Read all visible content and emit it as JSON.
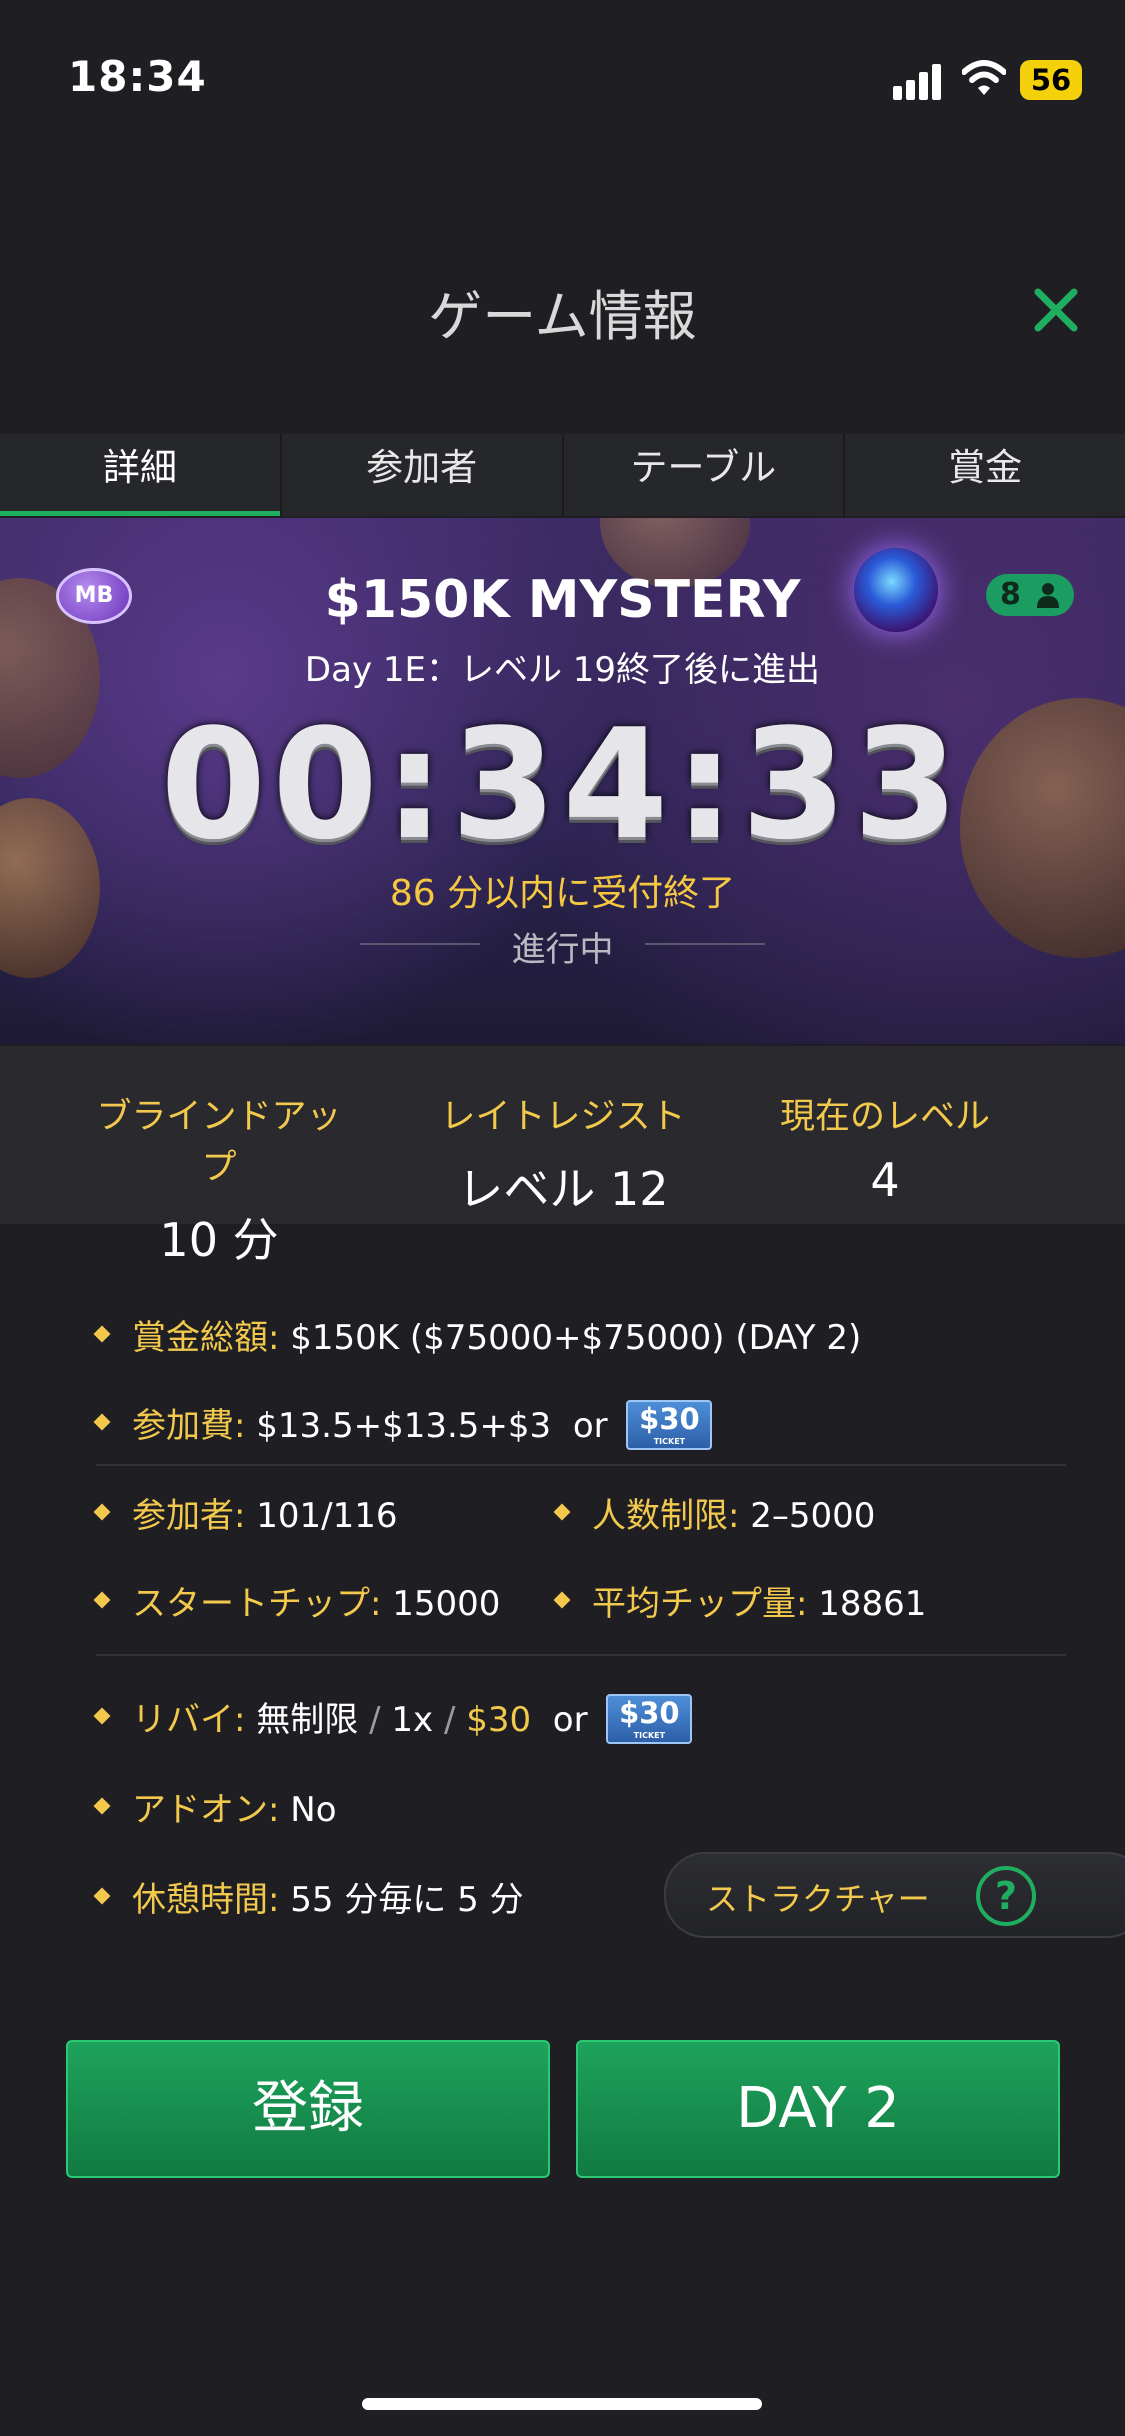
{
  "status_bar": {
    "time": "18:34",
    "battery": "56"
  },
  "header": {
    "title": "ゲーム情報"
  },
  "tabs": [
    {
      "label": "詳細",
      "active": true
    },
    {
      "label": "参加者",
      "active": false
    },
    {
      "label": "テーブル",
      "active": false
    },
    {
      "label": "賞金",
      "active": false
    }
  ],
  "banner": {
    "badge": "MB",
    "title": "$150K MYSTERY",
    "players": "8",
    "subtitle": "Day 1E：レベル 19終了後に進出",
    "countdown": "00:34:33",
    "registration_close": "86 分以内に受付終了",
    "status": "進行中"
  },
  "stats": {
    "blind_up": {
      "label": "ブラインドアップ",
      "value": "10 分"
    },
    "late_reg": {
      "label": "レイトレジスト",
      "value": "レベル 12"
    },
    "current_level": {
      "label": "現在のレベル",
      "value": "4"
    }
  },
  "info": {
    "prize_pool": {
      "key": "賞金総額:",
      "value": "$150K ($75000+$75000) (DAY 2)"
    },
    "buyin": {
      "key": "参加費:",
      "value": "$13.5+$13.5+$3",
      "or": "or",
      "ticket": "$30",
      "ticket_sub": "TICKET"
    },
    "entrants": {
      "key": "参加者:",
      "value": "101/116"
    },
    "player_limit": {
      "key": "人数制限:",
      "value": "2–5000"
    },
    "starting_chips": {
      "key": "スタートチップ:",
      "value": "15000"
    },
    "avg_chips": {
      "key": "平均チップ量:",
      "value": "18861"
    },
    "rebuy": {
      "key": "リバイ:",
      "value_a": "無制限",
      "slash": "/",
      "value_b": "1x",
      "value_c": "$30",
      "or": "or",
      "ticket": "$30",
      "ticket_sub": "TICKET"
    },
    "addon": {
      "key": "アドオン:",
      "value": "No"
    },
    "break": {
      "key": "休憩時間:",
      "value": "55 分毎に 5 分"
    }
  },
  "structure_button": {
    "label": "ストラクチャー",
    "icon": "?"
  },
  "actions": {
    "register": "登録",
    "day2": "DAY 2"
  },
  "colors": {
    "accent": "#1fae60",
    "gold": "#f2c94c",
    "background": "#1f1f23"
  }
}
